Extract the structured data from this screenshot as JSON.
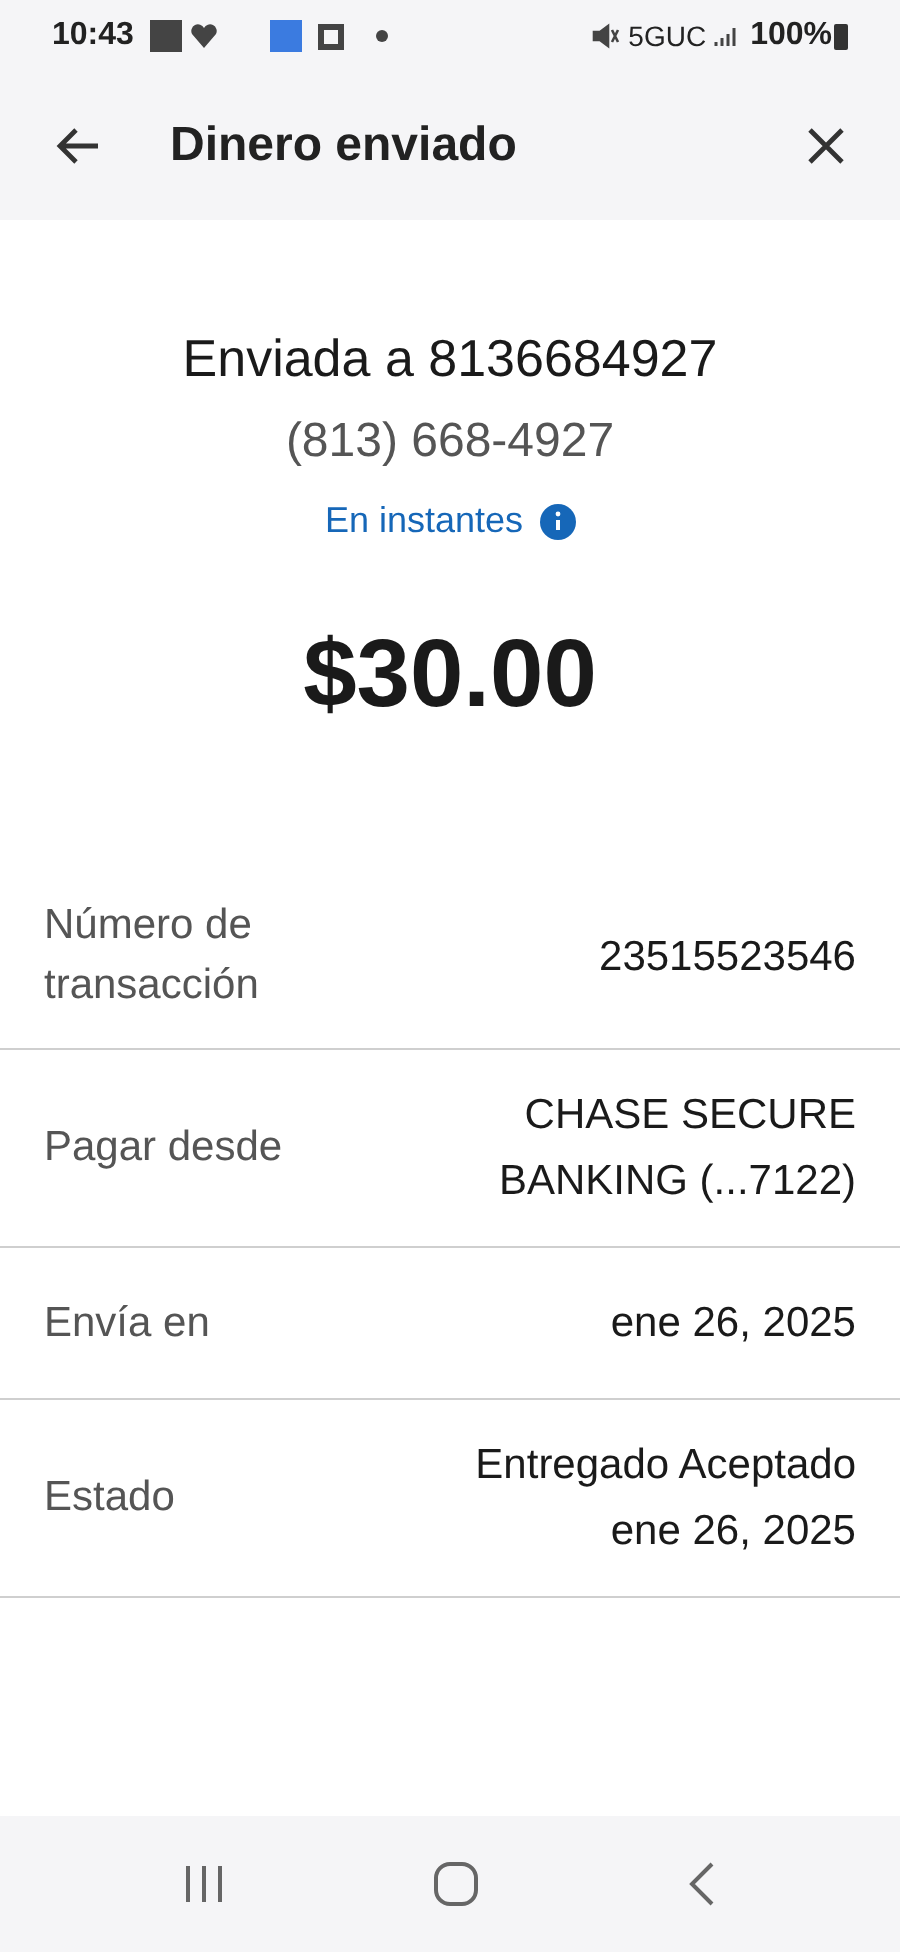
{
  "status_bar": {
    "time": "10:43",
    "network": "5GUC",
    "battery": "100%"
  },
  "header": {
    "title": "Dinero enviado"
  },
  "summary": {
    "recipient": "Enviada a 8136684927",
    "phone": "(813) 668-4927",
    "speed": "En instantes",
    "amount": "$30.00"
  },
  "details": [
    {
      "label": "Número de transacción",
      "value": "23515523546"
    },
    {
      "label": "Pagar desde",
      "value": "CHASE SECURE BANKING (...7122)"
    },
    {
      "label": "Envía en",
      "value": "ene 26, 2025"
    },
    {
      "label": "Estado",
      "value": "Entregado Aceptado ene 26, 2025"
    }
  ]
}
